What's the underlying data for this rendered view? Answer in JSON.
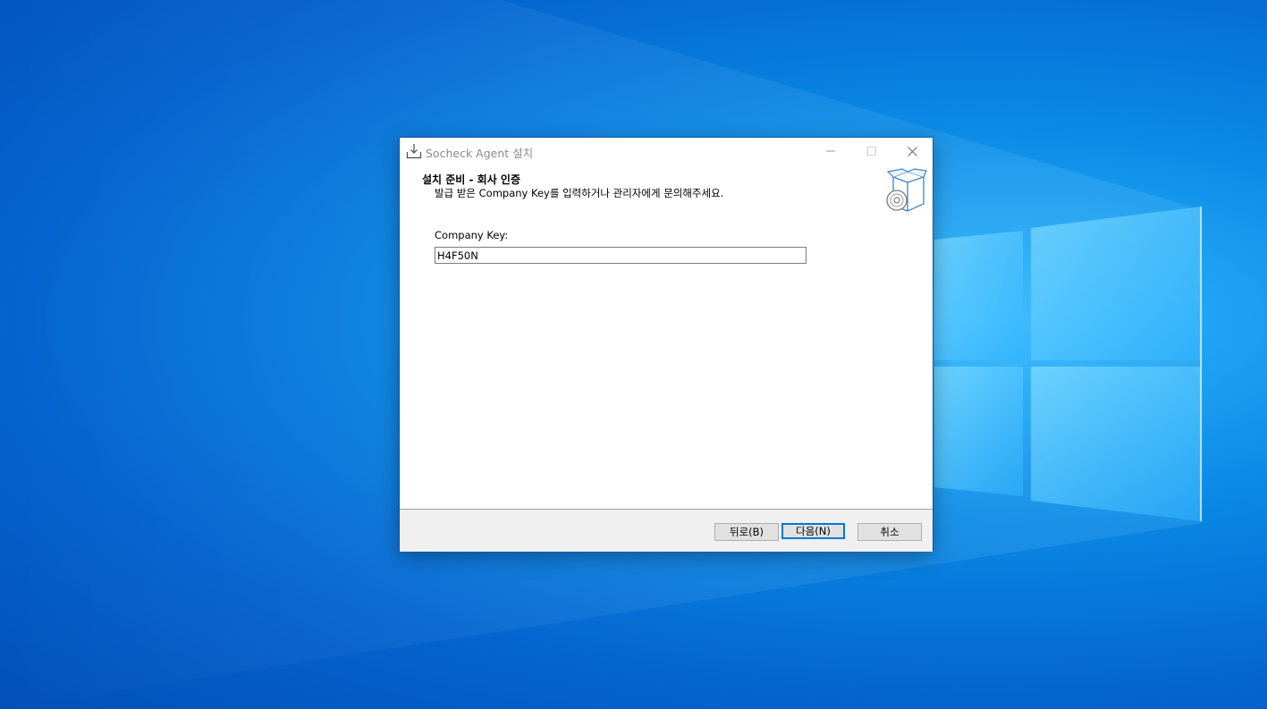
{
  "window": {
    "title": "Socheck Agent 설치"
  },
  "header": {
    "title": "설치 준비 - 회사 인증",
    "subtitle": "발급 받은 Company Key를 입력하거나 관리자에게 문의해주세요."
  },
  "form": {
    "company_key_label": "Company Key:",
    "company_key_value": "H4F50N"
  },
  "buttons": {
    "back": "뒤로(B)",
    "next": "다음(N)",
    "cancel": "취소"
  },
  "icons": {
    "app": "installer-download-icon",
    "header": "software-box-cd-icon",
    "minimize": "minimize-icon",
    "maximize": "maximize-icon",
    "close": "close-icon"
  },
  "colors": {
    "desktop": "#0a8ae6",
    "focus_border": "#0078d7",
    "footer_bg": "#f0f0f0"
  }
}
